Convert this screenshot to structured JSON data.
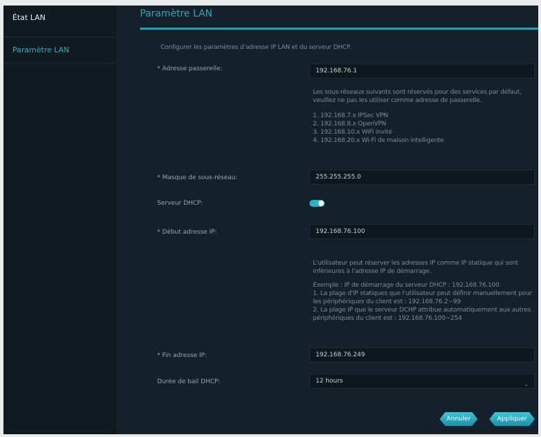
{
  "sidebar": {
    "items": [
      {
        "label": "État LAN"
      },
      {
        "label": "Paramètre LAN"
      }
    ]
  },
  "tab": {
    "title": "Paramètre LAN"
  },
  "form": {
    "intro": "Configurer les paramètres d'adresse IP LAN et du serveur DHCP.",
    "gateway": {
      "label": "* Adresse passerelle:",
      "value": "192.168.76.1"
    },
    "reserved_info": [
      "Les sous-réseaux suivants sont réservés pour des services par défaut, veuillez ne pas les utiliser comme adresse de passerelle.",
      "",
      "1. 192.168.7.x IPSec VPN",
      "2. 192.168.8.x OpenVPN",
      "3. 192.168.10.x WiFi invité",
      "4. 192.168.20.x Wi-Fi de maison intelligente"
    ],
    "mask": {
      "label": "* Masque de sous-réseau:",
      "value": "255.255.255.0"
    },
    "dhcp": {
      "label": "Serveur DHCP:",
      "enabled": true
    },
    "start_ip": {
      "label": "* Début adresse IP:",
      "value": "192.168.76.100"
    },
    "static_info": [
      "L'utilisateur peut réserver les adresses IP comme IP statique qui sont inférieures à l'adresse IP de démarrage.",
      "",
      "Exemple : IP de démarrage du serveur DHCP : 192.168.76.100",
      "1. La plage d'IP statiques que l'utilisateur peut définir manuellement pour les périphériques du client est : 192.168.76.2~99",
      "2. La plage IP que le serveur DCHP attribue automatiquement aux autres périphériques du client est : 192.168.76.100~254"
    ],
    "end_ip": {
      "label": "* Fin adresse IP:",
      "value": "192.168.76.249"
    },
    "lease": {
      "label": "Durée de bail DHCP:",
      "value": "12 hours"
    }
  },
  "buttons": {
    "cancel": "Annuler",
    "apply": "Appliquer"
  }
}
